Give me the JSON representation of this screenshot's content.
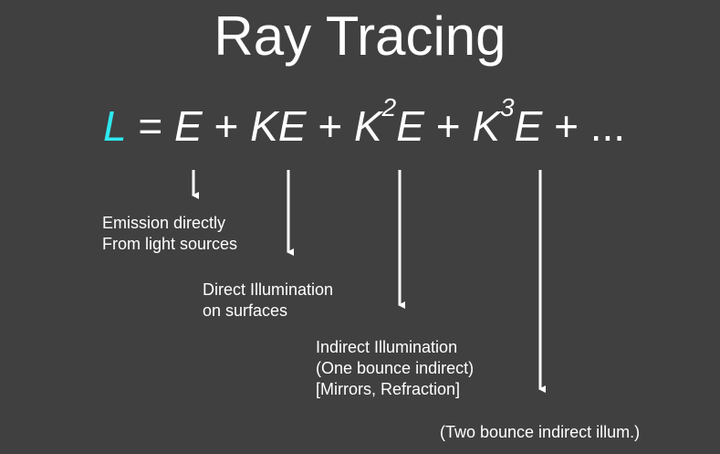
{
  "title": "Ray Tracing",
  "equation": {
    "lhs": "L",
    "eq_sign": "=",
    "t1": "E",
    "plus1": "+",
    "t2": "KE",
    "plus2": "+",
    "t3_k": "K",
    "t3_exp": "2",
    "t3_e": "E",
    "plus3": "+",
    "t4_k": "K",
    "t4_exp": "3",
    "t4_e": "E",
    "plus4": "+",
    "ellipsis": "...",
    "lhs_color": "#2ee8f0"
  },
  "notes": {
    "emission": [
      "Emission directly",
      "From light sources"
    ],
    "direct": [
      "Direct Illumination",
      "on surfaces"
    ],
    "indirect": [
      "Indirect Illumination",
      "(One bounce indirect)",
      "[Mirrors, Refraction]"
    ],
    "two_bounce": "(Two bounce indirect illum.)"
  }
}
